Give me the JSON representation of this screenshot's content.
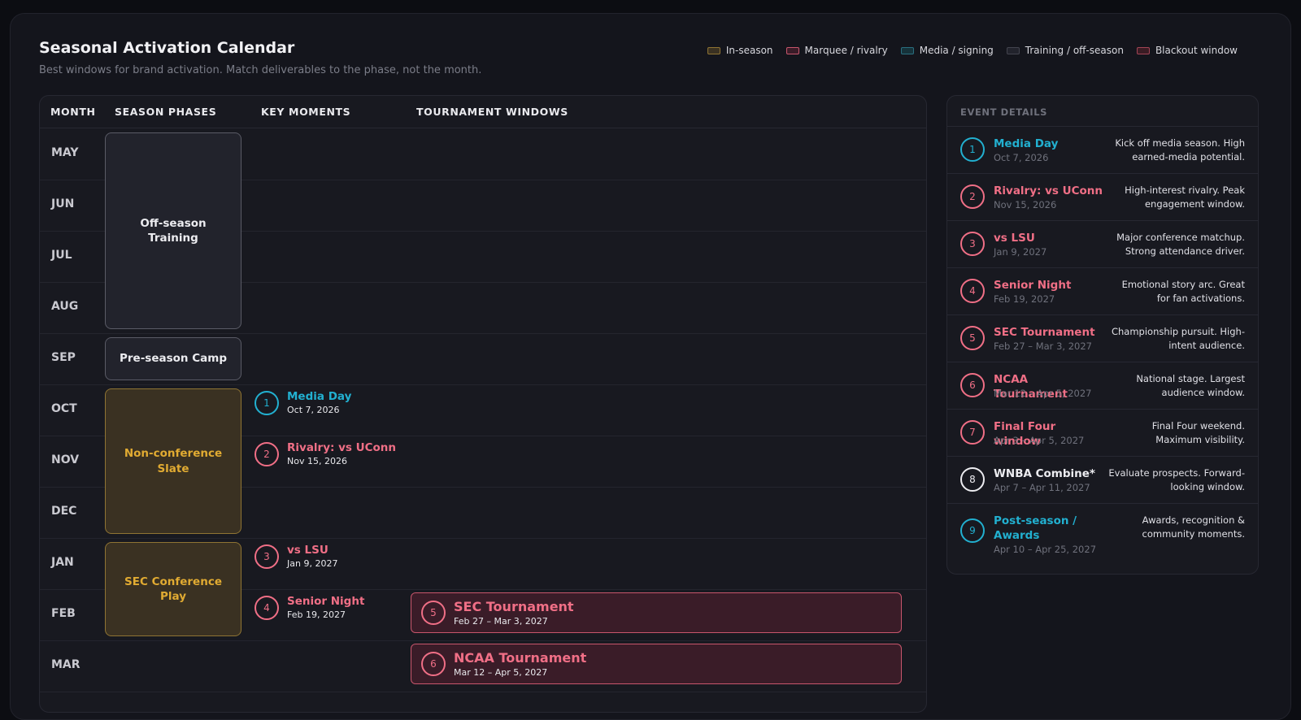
{
  "header": {
    "title": "Seasonal Activation Calendar",
    "subtitle": "Best windows for brand activation. Match deliverables to the phase, not the month."
  },
  "legend": [
    {
      "label": "In-season",
      "fill": "#3a3122",
      "border": "#8f7433"
    },
    {
      "label": "Marquee / rivalry",
      "fill": "#3a1c28",
      "border": "#c8566c"
    },
    {
      "label": "Media / signing",
      "fill": "#16323a",
      "border": "#2a6f80"
    },
    {
      "label": "Training / off-season",
      "fill": "#22232c",
      "border": "#43444e"
    },
    {
      "label": "Blackout window",
      "fill": "#3a1c24",
      "border": "#a34455"
    }
  ],
  "columns": {
    "month": "MONTH",
    "phases": "SEASON PHASES",
    "moments": "KEY MOMENTS",
    "tournaments": "TOURNAMENT WINDOWS"
  },
  "months": [
    "MAY",
    "JUN",
    "JUL",
    "AUG",
    "SEP",
    "OCT",
    "NOV",
    "DEC",
    "JAN",
    "FEB",
    "MAR"
  ],
  "phases": {
    "offseason": "Off-season Training",
    "preseason": "Pre-season Camp",
    "nonconf": "Non-conference Slate",
    "sec": "SEC Conference Play"
  },
  "moments": [
    {
      "num": "1",
      "name": "Media Day",
      "date": "Oct 7, 2026",
      "color": "#22b0d0"
    },
    {
      "num": "2",
      "name": "Rivalry: vs UConn",
      "date": "Nov 15, 2026",
      "color": "#f06f86"
    },
    {
      "num": "3",
      "name": "vs LSU",
      "date": "Jan 9, 2027",
      "color": "#f06f86"
    },
    {
      "num": "4",
      "name": "Senior Night",
      "date": "Feb 19, 2027",
      "color": "#f06f86"
    }
  ],
  "tournaments": [
    {
      "num": "5",
      "name": "SEC Tournament",
      "date": "Feb 27 – Mar 3, 2027"
    },
    {
      "num": "6",
      "name": "NCAA Tournament",
      "date": "Mar 12 – Apr 5, 2027"
    }
  ],
  "event_details": {
    "heading": "EVENT DETAILS",
    "events": [
      {
        "num": "1",
        "name": "Media Day",
        "date": "Oct 7, 2026",
        "desc": "Kick off media season. High earned-media potential.",
        "color": "#22b0d0"
      },
      {
        "num": "2",
        "name": "Rivalry: vs UConn",
        "date": "Nov 15, 2026",
        "desc": "High-interest rivalry. Peak engagement window.",
        "color": "#f06f86"
      },
      {
        "num": "3",
        "name": "vs LSU",
        "date": "Jan 9, 2027",
        "desc": "Major conference matchup. Strong attendance driver.",
        "color": "#f06f86"
      },
      {
        "num": "4",
        "name": "Senior Night",
        "date": "Feb 19, 2027",
        "desc": "Emotional story arc. Great for fan activations.",
        "color": "#f06f86"
      },
      {
        "num": "5",
        "name": "SEC Tournament",
        "date": "Feb 27 – Mar 3, 2027",
        "desc": "Championship pursuit. High-intent audience.",
        "color": "#f06f86"
      },
      {
        "num": "6",
        "name": "NCAA Tournament",
        "date": "Mar 12 – Apr 5, 2027",
        "desc": "National stage. Largest audience window.",
        "color": "#f06f86"
      },
      {
        "num": "7",
        "name": "Final Four window",
        "date": "Apr 3 – Apr 5, 2027",
        "desc": "Final Four weekend. Maximum visibility.",
        "color": "#f06f86"
      },
      {
        "num": "8",
        "name": "WNBA Combine*",
        "date": "Apr 7 – Apr 11, 2027",
        "desc": "Evaluate prospects. Forward-looking window.",
        "color": "#ececf0"
      },
      {
        "num": "9",
        "name": "Post-season / Awards",
        "date": "Apr 10 – Apr 25, 2027",
        "desc": "Awards, recognition & community moments.",
        "color": "#22b0d0"
      }
    ]
  }
}
